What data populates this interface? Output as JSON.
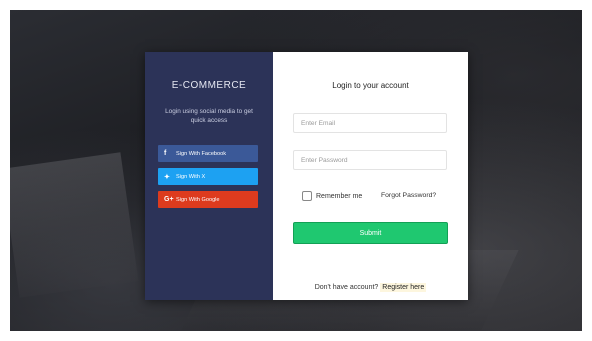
{
  "left_panel": {
    "brand": "E-COMMERCE",
    "subtitle": "Login using social media to get quick access",
    "social_buttons": [
      {
        "label": "Sign With Facebook",
        "icon": "f",
        "color": "#3b5998"
      },
      {
        "label": "Sign With X",
        "icon": "✦",
        "color": "#1da1f2"
      },
      {
        "label": "Sign With Google",
        "icon": "G+",
        "color": "#dd3b1e"
      }
    ]
  },
  "right_panel": {
    "title": "Login to your account",
    "email_placeholder": "Enter Email",
    "password_placeholder": "Enter Password",
    "remember_label": "Remember me",
    "forgot_label": "Forgot Password?",
    "submit_label": "Submit",
    "register_prompt": "Don't have account?",
    "register_link": "Register here"
  },
  "colors": {
    "panel_dark": "#2c3358",
    "submit_green": "#1fc870"
  }
}
